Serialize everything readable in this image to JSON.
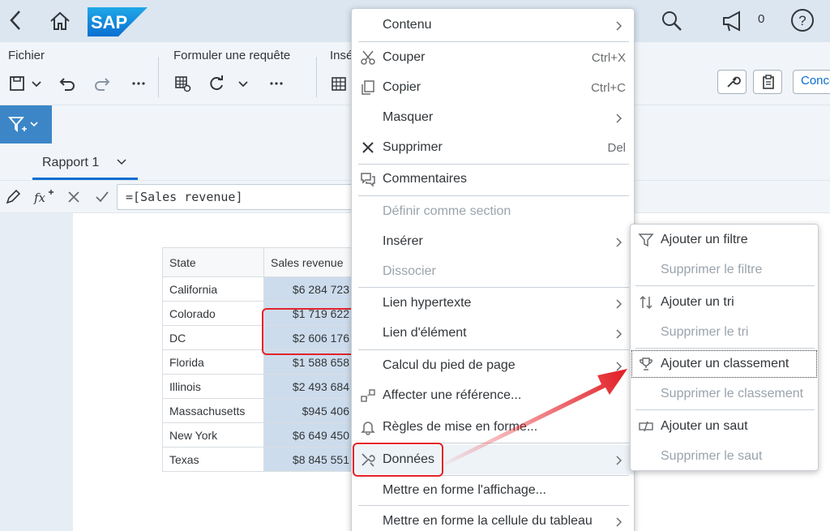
{
  "shell": {
    "logo_text": "SAP",
    "notification_count": "0"
  },
  "toolbar": {
    "group_file": "Fichier",
    "group_query": "Formuler une requête",
    "group_insert": "Insé",
    "conception_label": "Conce"
  },
  "tabs": [
    {
      "label": "Rapport 1"
    }
  ],
  "formula": {
    "value": "=[Sales revenue]"
  },
  "table": {
    "headers": [
      "State",
      "Sales revenue"
    ],
    "rows": [
      {
        "state": "California",
        "revenue": "$6 284 723"
      },
      {
        "state": "Colorado",
        "revenue": "$1 719 622"
      },
      {
        "state": "DC",
        "revenue": "$2 606 176"
      },
      {
        "state": "Florida",
        "revenue": "$1 588 658"
      },
      {
        "state": "Illinois",
        "revenue": "$2 493 684"
      },
      {
        "state": "Massachusetts",
        "revenue": "$945 406"
      },
      {
        "state": "New York",
        "revenue": "$6 649 450"
      },
      {
        "state": "Texas",
        "revenue": "$8 845 551"
      }
    ]
  },
  "context_menu": {
    "items": [
      {
        "label": "Contenu",
        "shortcut": "",
        "submenu": true,
        "disabled": false,
        "icon": ""
      },
      {
        "label": "Couper",
        "shortcut": "Ctrl+X",
        "submenu": false,
        "disabled": false,
        "icon": "scissors-icon"
      },
      {
        "label": "Copier",
        "shortcut": "Ctrl+C",
        "submenu": false,
        "disabled": false,
        "icon": "copy-icon"
      },
      {
        "label": "Masquer",
        "shortcut": "",
        "submenu": true,
        "disabled": false,
        "icon": ""
      },
      {
        "label": "Supprimer",
        "shortcut": "Del",
        "submenu": false,
        "disabled": false,
        "icon": "close-icon"
      },
      {
        "label": "Commentaires",
        "shortcut": "",
        "submenu": false,
        "disabled": false,
        "icon": "comments-icon"
      },
      {
        "label": "Définir comme section",
        "shortcut": "",
        "submenu": false,
        "disabled": true,
        "icon": ""
      },
      {
        "label": "Insérer",
        "shortcut": "",
        "submenu": true,
        "disabled": false,
        "icon": ""
      },
      {
        "label": "Dissocier",
        "shortcut": "",
        "submenu": false,
        "disabled": true,
        "icon": ""
      },
      {
        "label": "Lien hypertexte",
        "shortcut": "",
        "submenu": true,
        "disabled": false,
        "icon": ""
      },
      {
        "label": "Lien d'élément",
        "shortcut": "",
        "submenu": true,
        "disabled": false,
        "icon": ""
      },
      {
        "label": "Calcul du pied de page",
        "shortcut": "",
        "submenu": true,
        "disabled": false,
        "icon": ""
      },
      {
        "label": "Affecter une référence...",
        "shortcut": "",
        "submenu": false,
        "disabled": false,
        "icon": "reference-icon"
      },
      {
        "label": "Règles de mise en forme...",
        "shortcut": "",
        "submenu": false,
        "disabled": false,
        "icon": "bell-icon"
      },
      {
        "label": "Données",
        "shortcut": "",
        "submenu": true,
        "disabled": false,
        "icon": "tools-icon"
      },
      {
        "label": "Mettre en forme l'affichage...",
        "shortcut": "",
        "submenu": false,
        "disabled": false,
        "icon": ""
      },
      {
        "label": "Mettre en forme la cellule du tableau",
        "shortcut": "",
        "submenu": true,
        "disabled": false,
        "icon": ""
      }
    ]
  },
  "data_submenu": {
    "items": [
      {
        "label": "Ajouter un filtre",
        "disabled": false,
        "icon": "filter-icon"
      },
      {
        "label": "Supprimer le filtre",
        "disabled": true,
        "icon": ""
      },
      {
        "label": "Ajouter un tri",
        "disabled": false,
        "icon": "sort-icon"
      },
      {
        "label": "Supprimer le tri",
        "disabled": true,
        "icon": ""
      },
      {
        "label": "Ajouter un classement",
        "disabled": false,
        "icon": "trophy-icon"
      },
      {
        "label": "Supprimer le classement",
        "disabled": true,
        "icon": ""
      },
      {
        "label": "Ajouter un saut",
        "disabled": false,
        "icon": "break-icon"
      },
      {
        "label": "Supprimer le saut",
        "disabled": true,
        "icon": ""
      }
    ]
  },
  "colors": {
    "shell_bg": "#dbe6f1",
    "accent": "#0a6ed1",
    "highlight_red": "#e3242b",
    "selected_cells": "#cddcec"
  }
}
